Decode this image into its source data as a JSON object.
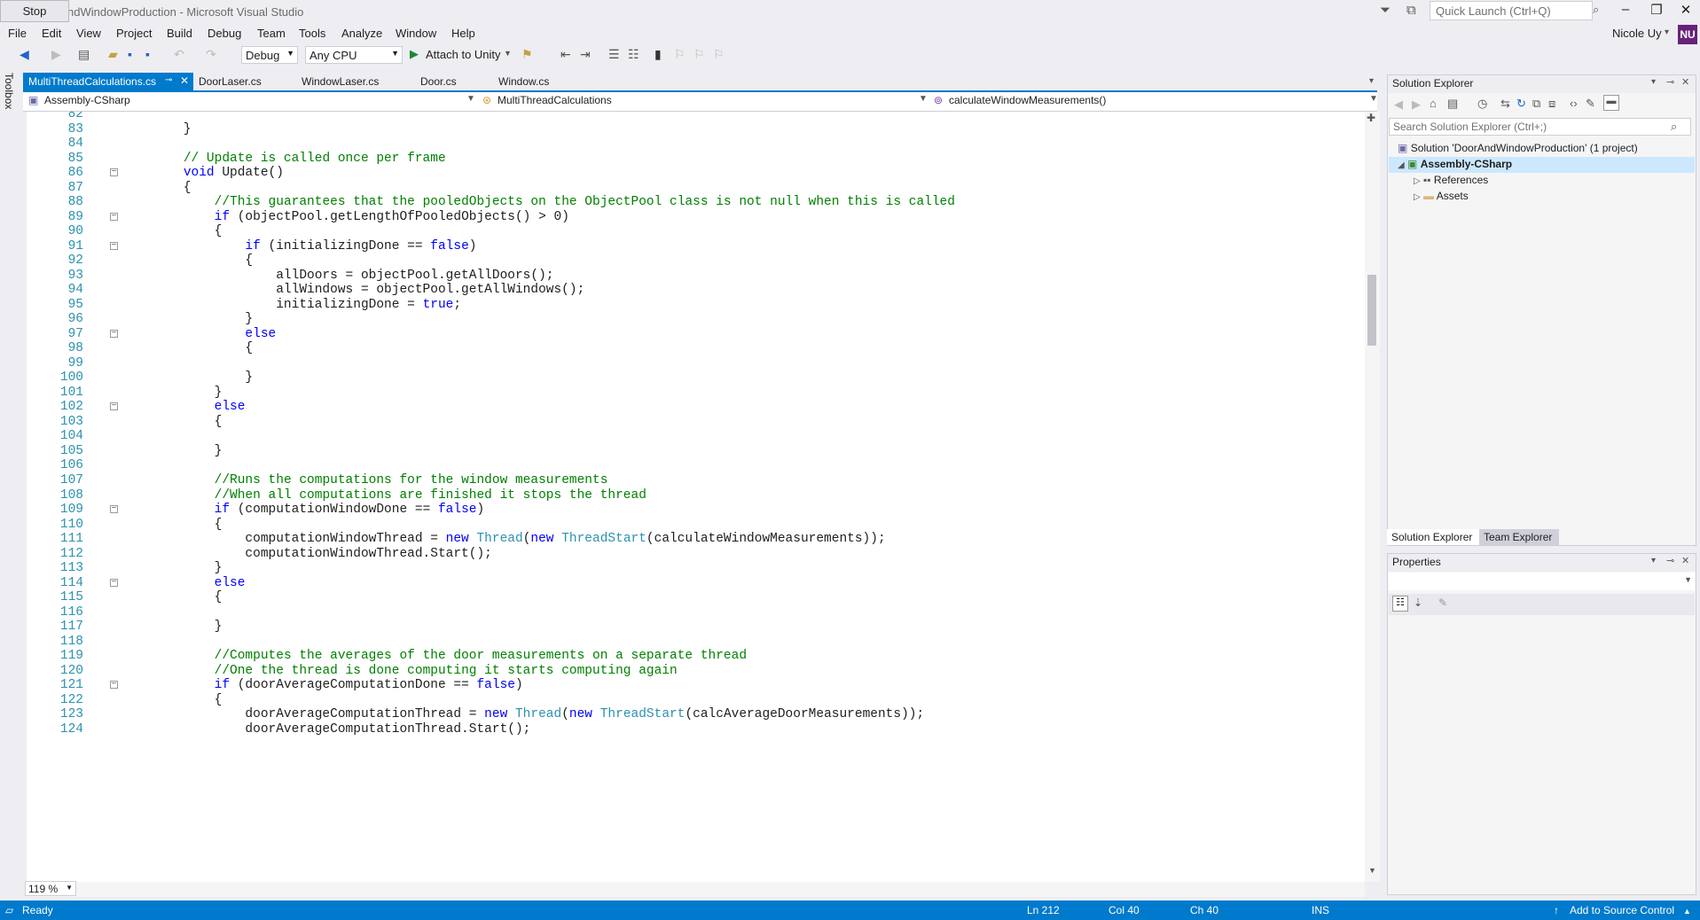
{
  "window": {
    "title": "ndWindowProduction - Microsoft Visual Studio",
    "stop_label": "Stop",
    "quick_launch_placeholder": "Quick Launch (Ctrl+Q)",
    "user_name": "Nicole Uy",
    "user_initials": "NU"
  },
  "menu": [
    "File",
    "Edit",
    "View",
    "Project",
    "Build",
    "Debug",
    "Team",
    "Tools",
    "Analyze",
    "Window",
    "Help"
  ],
  "toolbar": {
    "config": "Debug",
    "platform": "Any CPU",
    "attach": "Attach to Unity"
  },
  "toolbox_label": "Toolbox",
  "tabs": [
    {
      "label": "MultiThreadCalculations.cs",
      "active": true
    },
    {
      "label": "DoorLaser.cs",
      "active": false
    },
    {
      "label": "WindowLaser.cs",
      "active": false
    },
    {
      "label": "Door.cs",
      "active": false
    },
    {
      "label": "Window.cs",
      "active": false
    }
  ],
  "navbar": {
    "project": "Assembly-CSharp",
    "class": "MultiThreadCalculations",
    "member": "calculateWindowMeasurements()"
  },
  "code_lines": [
    {
      "n": "82",
      "t": ""
    },
    {
      "n": "83",
      "t": "    }"
    },
    {
      "n": "84",
      "t": ""
    },
    {
      "n": "85",
      "t": "    // Update is called once per frame"
    },
    {
      "n": "86",
      "t": "    void Update()",
      "fold": true
    },
    {
      "n": "87",
      "t": "    {"
    },
    {
      "n": "88",
      "t": "        //This guarantees that the pooledObjects on the ObjectPool class is not null when this is called"
    },
    {
      "n": "89",
      "t": "        if (objectPool.getLengthOfPooledObjects() > 0)",
      "fold": true
    },
    {
      "n": "90",
      "t": "        {"
    },
    {
      "n": "91",
      "t": "            if (initializingDone == false)",
      "fold": true
    },
    {
      "n": "92",
      "t": "            {"
    },
    {
      "n": "93",
      "t": "                allDoors = objectPool.getAllDoors();"
    },
    {
      "n": "94",
      "t": "                allWindows = objectPool.getAllWindows();"
    },
    {
      "n": "95",
      "t": "                initializingDone = true;"
    },
    {
      "n": "96",
      "t": "            }"
    },
    {
      "n": "97",
      "t": "            else",
      "fold": true
    },
    {
      "n": "98",
      "t": "            {"
    },
    {
      "n": "99",
      "t": ""
    },
    {
      "n": "100",
      "t": "            }"
    },
    {
      "n": "101",
      "t": "        }"
    },
    {
      "n": "102",
      "t": "        else",
      "fold": true
    },
    {
      "n": "103",
      "t": "        {"
    },
    {
      "n": "104",
      "t": ""
    },
    {
      "n": "105",
      "t": "        }"
    },
    {
      "n": "106",
      "t": ""
    },
    {
      "n": "107",
      "t": "        //Runs the computations for the window measurements"
    },
    {
      "n": "108",
      "t": "        //When all computations are finished it stops the thread"
    },
    {
      "n": "109",
      "t": "        if (computationWindowDone == false)",
      "fold": true
    },
    {
      "n": "110",
      "t": "        {"
    },
    {
      "n": "111",
      "t": "            computationWindowThread = new Thread(new ThreadStart(calculateWindowMeasurements));"
    },
    {
      "n": "112",
      "t": "            computationWindowThread.Start();"
    },
    {
      "n": "113",
      "t": "        }"
    },
    {
      "n": "114",
      "t": "        else",
      "fold": true
    },
    {
      "n": "115",
      "t": "        {"
    },
    {
      "n": "116",
      "t": ""
    },
    {
      "n": "117",
      "t": "        }"
    },
    {
      "n": "118",
      "t": ""
    },
    {
      "n": "119",
      "t": "        //Computes the averages of the door measurements on a separate thread"
    },
    {
      "n": "120",
      "t": "        //One the thread is done computing it starts computing again"
    },
    {
      "n": "121",
      "t": "        if (doorAverageComputationDone == false)",
      "fold": true
    },
    {
      "n": "122",
      "t": "        {"
    },
    {
      "n": "123",
      "t": "            doorAverageComputationThread = new Thread(new ThreadStart(calcAverageDoorMeasurements));"
    },
    {
      "n": "124",
      "t": "            doorAverageComputationThread.Start();"
    }
  ],
  "zoom": "119 %",
  "solution_explorer": {
    "title": "Solution Explorer",
    "search_placeholder": "Search Solution Explorer (Ctrl+;)",
    "solution": "Solution 'DoorAndWindowProduction' (1 project)",
    "project": "Assembly-CSharp",
    "items": [
      "References",
      "Assets"
    ],
    "tab_solution": "Solution Explorer",
    "tab_team": "Team Explorer"
  },
  "properties": {
    "title": "Properties"
  },
  "status": {
    "ready": "Ready",
    "ln": "Ln 212",
    "col": "Col 40",
    "ch": "Ch 40",
    "ins": "INS",
    "source_control": "Add to Source Control"
  },
  "colors": {
    "accent": "#007acc",
    "keyword": "#0000ff",
    "comment": "#008000",
    "type": "#2b91af",
    "avatar": "#68217a"
  }
}
